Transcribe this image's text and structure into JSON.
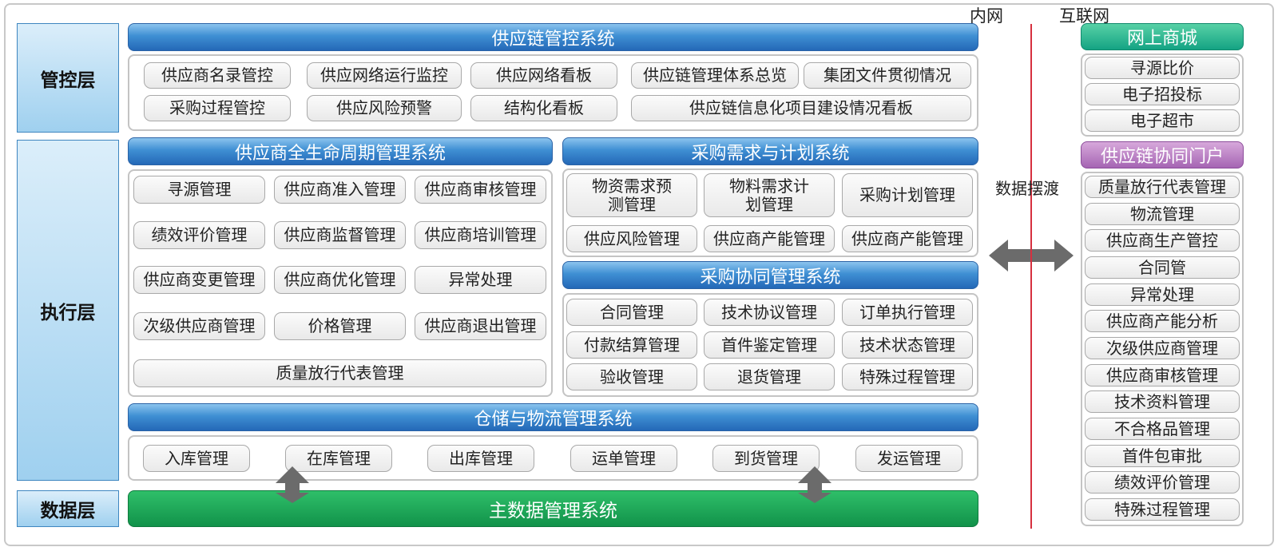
{
  "layers": {
    "control": "管控层",
    "execution": "执行层",
    "data": "数据层"
  },
  "control_system": {
    "title": "供应链管控系统",
    "items": [
      "供应商名录管控",
      "供应网络运行监控",
      "供应网络看板",
      "供应链管理体系总览",
      "集团文件贯彻情况",
      "采购过程管控",
      "供应风险预警",
      "结构化看板",
      "供应链信息化项目建设情况看板"
    ]
  },
  "lifecycle_system": {
    "title": "供应商全生命周期管理系统",
    "items": [
      "寻源管理",
      "供应商准入管理",
      "供应商审核管理",
      "绩效评价管理",
      "供应商监督管理",
      "供应商培训管理",
      "供应商变更管理",
      "供应商优化管理",
      "异常处理",
      "次级供应商管理",
      "价格管理",
      "供应商退出管理",
      "质量放行代表管理"
    ]
  },
  "demand_system": {
    "title": "采购需求与计划系统",
    "items": [
      "物资需求预测管理",
      "物料需求计划管理",
      "采购计划管理",
      "供应风险管理",
      "供应商产能管理",
      "供应商产能管理"
    ]
  },
  "collab_system": {
    "title": "采购协同管理系统",
    "items": [
      "合同管理",
      "技术协议管理",
      "订单执行管理",
      "付款结算管理",
      "首件鉴定管理",
      "技术状态管理",
      "验收管理",
      "退货管理",
      "特殊过程管理"
    ]
  },
  "warehouse_system": {
    "title": "仓储与物流管理系统",
    "items": [
      "入库管理",
      "在库管理",
      "出库管理",
      "运单管理",
      "到货管理",
      "发运管理"
    ]
  },
  "master_data": {
    "title": "主数据管理系统"
  },
  "network": {
    "intranet": "内网",
    "internet": "互联网",
    "ferry": "数据摆渡"
  },
  "mall": {
    "title": "网上商城",
    "items": [
      "寻源比价",
      "电子招投标",
      "电子超市"
    ]
  },
  "portal": {
    "title": "供应链协同门户",
    "items": [
      "质量放行代表管理",
      "物流管理",
      "供应商生产管控",
      "合同管",
      "异常处理",
      "供应商产能分析",
      "次级供应商管理",
      "供应商审核管理",
      "技术资料管理",
      "不合格品管理",
      "首件包审批",
      "绩效评价管理",
      "特殊过程管理"
    ]
  },
  "colors": {
    "system_blue": "#3f8fd3",
    "master_green": "#11924a",
    "mall_teal": "#14a383",
    "portal_purple": "#a565b3",
    "divider_red": "#d6303f",
    "arrow_gray": "#6b6b6b"
  }
}
